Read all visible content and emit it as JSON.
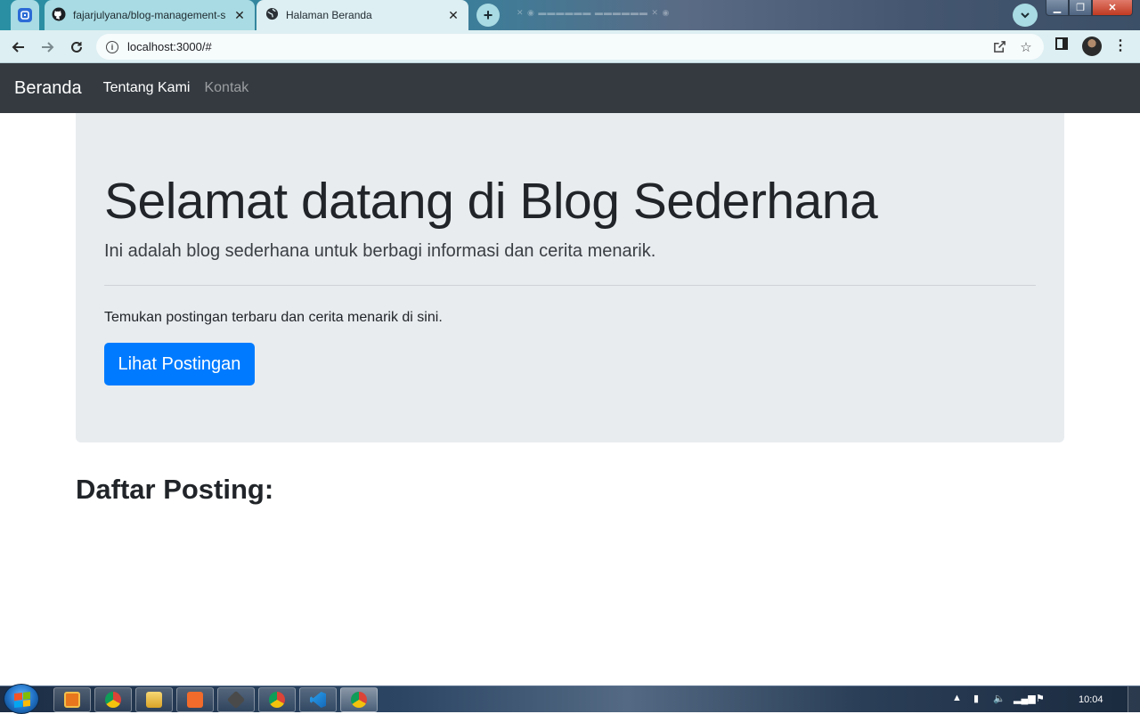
{
  "browser": {
    "tabs": [
      {
        "title": "fajarjulyana/blog-management-s",
        "icon": "github-icon"
      },
      {
        "title": "Halaman Beranda",
        "icon": "globe-icon",
        "active": true
      }
    ],
    "url": "localhost:3000/#"
  },
  "navbar": {
    "brand": "Beranda",
    "links": [
      {
        "label": "Tentang Kami",
        "active": true
      },
      {
        "label": "Kontak",
        "active": false
      }
    ]
  },
  "jumbotron": {
    "title": "Selamat datang di Blog Sederhana",
    "lead": "Ini adalah blog sederhana untuk berbagi informasi dan cerita menarik.",
    "text": "Temukan postingan terbaru dan cerita menarik di sini.",
    "button_label": "Lihat Postingan"
  },
  "posts_section": {
    "title": "Daftar Posting:"
  },
  "taskbar": {
    "clock": "10:04"
  },
  "colors": {
    "navbar_bg": "#343a40",
    "jumbotron_bg": "#e9ecef",
    "primary": "#007bff"
  }
}
